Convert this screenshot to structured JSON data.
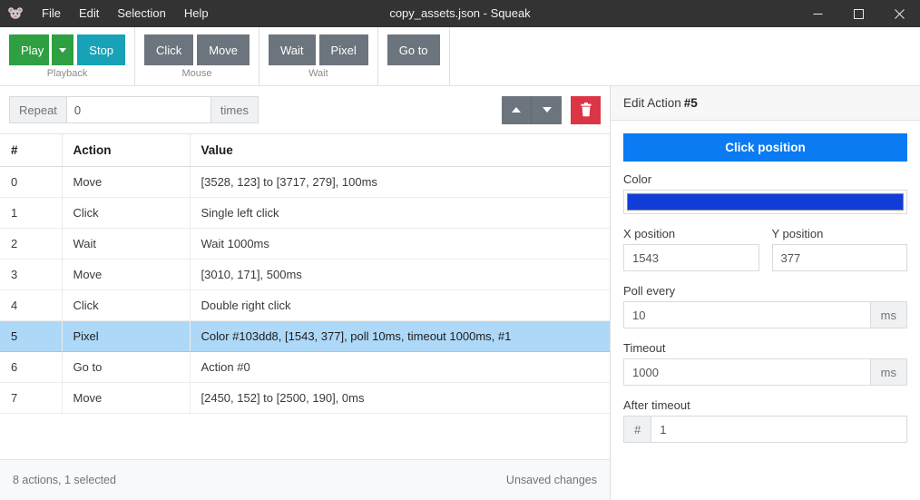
{
  "titlebar": {
    "app_icon": "mouse-icon",
    "title": "copy_assets.json - Squeak",
    "menus": [
      "File",
      "Edit",
      "Selection",
      "Help"
    ],
    "window_controls": {
      "minimize": "minimize-icon",
      "maximize": "maximize-icon",
      "close": "close-icon"
    },
    "background": "#333333"
  },
  "ribbon": {
    "groups": [
      {
        "label": "Playback",
        "buttons": [
          {
            "label": "Play",
            "style": "green",
            "has_caret": true,
            "color": "#2ea041"
          },
          {
            "label": "Stop",
            "style": "cyan",
            "color": "#17a2b8"
          }
        ]
      },
      {
        "label": "Mouse",
        "buttons": [
          {
            "label": "Click",
            "style": "gray",
            "color": "#6c757d"
          },
          {
            "label": "Move",
            "style": "gray",
            "color": "#6c757d"
          }
        ]
      },
      {
        "label": "Wait",
        "buttons": [
          {
            "label": "Wait",
            "style": "gray",
            "color": "#6c757d"
          },
          {
            "label": "Pixel",
            "style": "gray",
            "color": "#6c757d"
          }
        ]
      },
      {
        "label": "",
        "buttons": [
          {
            "label": "Go to",
            "style": "gray",
            "color": "#6c757d"
          }
        ]
      }
    ]
  },
  "repeat_bar": {
    "prefix_label": "Repeat",
    "value": "0",
    "placeholder": "0",
    "suffix_label": "times",
    "move_up_icon": "arrow-up-icon",
    "move_down_icon": "arrow-down-icon",
    "delete_icon": "trash-icon",
    "delete_color": "#dc3545"
  },
  "table": {
    "columns": [
      "#",
      "Action",
      "Value"
    ],
    "selected_index": 5,
    "rows": [
      {
        "index": "0",
        "action": "Move",
        "value": "[3528, 123] to [3717, 279], 100ms"
      },
      {
        "index": "1",
        "action": "Click",
        "value": "Single left click"
      },
      {
        "index": "2",
        "action": "Wait",
        "value": "Wait 1000ms"
      },
      {
        "index": "3",
        "action": "Move",
        "value": "[3010, 171], 500ms"
      },
      {
        "index": "4",
        "action": "Click",
        "value": "Double right click"
      },
      {
        "index": "5",
        "action": "Pixel",
        "value": "Color #103dd8, [1543, 377], poll 10ms, timeout 1000ms, #1"
      },
      {
        "index": "6",
        "action": "Go to",
        "value": "Action #0"
      },
      {
        "index": "7",
        "action": "Move",
        "value": "[2450, 152] to [2500, 190], 0ms"
      }
    ],
    "selected_row_color": "#aed8f7"
  },
  "statusbar": {
    "left": "8 actions, 1 selected",
    "right": "Unsaved changes"
  },
  "editor": {
    "header_prefix": "Edit Action",
    "header_number": "#5",
    "click_position_label": "Click position",
    "click_position_color": "#0a7bf2",
    "color_label": "Color",
    "color_value": "#103dd8",
    "x_label": "X position",
    "x_value": "1543",
    "y_label": "Y position",
    "y_value": "377",
    "poll_label": "Poll every",
    "poll_value": "10",
    "poll_unit": "ms",
    "timeout_label": "Timeout",
    "timeout_value": "1000",
    "timeout_unit": "ms",
    "after_timeout_label": "After timeout",
    "after_timeout_prefix": "#",
    "after_timeout_value": "1"
  }
}
